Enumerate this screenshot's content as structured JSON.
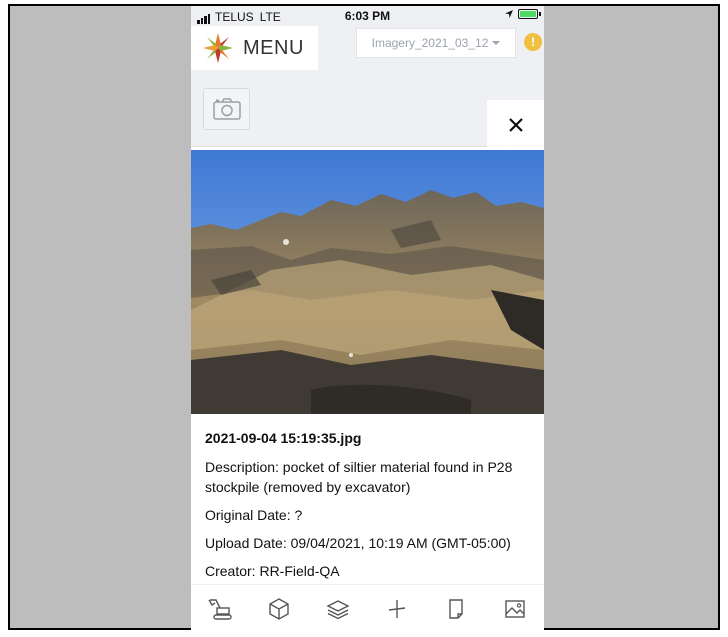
{
  "status_bar": {
    "carrier": "TELUS",
    "network": "LTE",
    "time": "6:03 PM"
  },
  "header": {
    "menu_label": "MENU",
    "imagery_selector": "Imagery_2021_03_12",
    "alert_symbol": "!"
  },
  "icons": {
    "camera": "camera-icon",
    "close": "close-icon",
    "toolbar": [
      "excavator-icon",
      "cube-icon",
      "layers-icon",
      "measure-icon",
      "document-icon",
      "image-icon"
    ]
  },
  "close_label": "✕",
  "photo_details": {
    "filename": "2021-09-04 15:19:35.jpg",
    "description": "Description: pocket of siltier material found in P28 stockpile (removed by excavator)",
    "original_date": "Original Date: ?",
    "upload_date": "Upload Date: 09/04/2021, 10:19 AM (GMT-05:00)",
    "creator": "Creator: RR-Field-QA"
  },
  "colors": {
    "alert": "#f2c040",
    "battery": "#4cd964",
    "background": "#bdbdbd"
  }
}
